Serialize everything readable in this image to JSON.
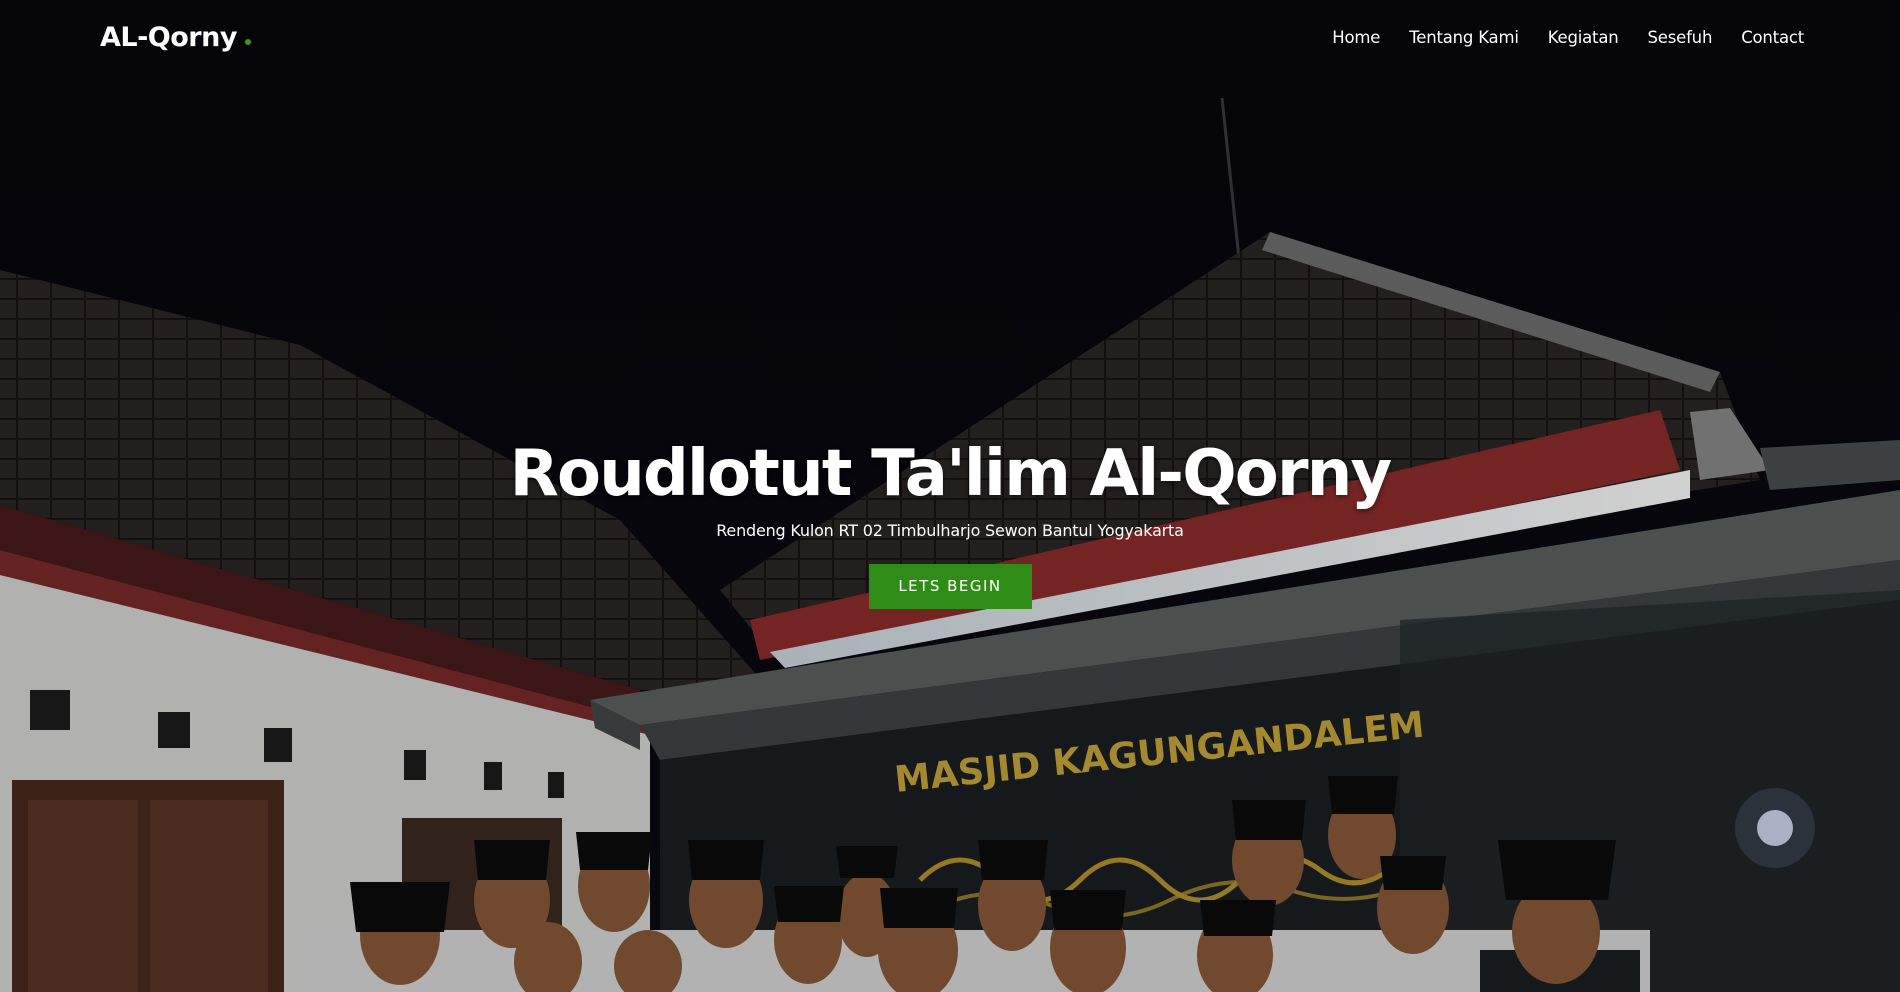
{
  "brand": {
    "name": "AL-Qorny",
    "accent_color": "#3a9a1a"
  },
  "nav": {
    "items": [
      {
        "label": "Home"
      },
      {
        "label": "Tentang Kami"
      },
      {
        "label": "Kegiatan"
      },
      {
        "label": "Sesefuh"
      },
      {
        "label": "Contact"
      }
    ]
  },
  "hero": {
    "title": "Roudlotut Ta'lim Al-Qorny",
    "subtitle": "Rendeng Kulon RT 02 Timbulharjo Sewon Bantul Yogyakarta",
    "cta_label": "LETS BEGIN",
    "cta_color": "#2f8c17",
    "sign_text": "MASJID KAGUNGANDALEM"
  }
}
